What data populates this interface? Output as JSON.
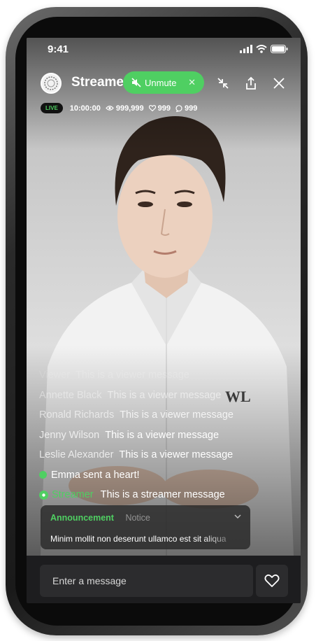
{
  "status_bar": {
    "time": "9:41"
  },
  "header": {
    "streamer_name": "Streame",
    "unmute_label": "Unmute"
  },
  "stats": {
    "live_badge": "LIVE",
    "duration": "10:00:00",
    "views": "999,999",
    "likes": "999",
    "comments": "999"
  },
  "video": {
    "watermark": "WL"
  },
  "chat": {
    "messages": [
      {
        "user": "Viewer",
        "text": "This is a viewer message"
      },
      {
        "user": "Annette Black",
        "text": "This is a viewer message"
      },
      {
        "user": "Ronald Richards",
        "text": "This is a viewer message"
      },
      {
        "user": "Jenny Wilson",
        "text": "This is a viewer message"
      },
      {
        "user": "Leslie Alexander",
        "text": "This is a viewer message"
      }
    ],
    "heart_event": "Emma sent a heart!",
    "streamer_message": {
      "user": "Streamer",
      "text": "This is a streamer message"
    }
  },
  "announcement": {
    "title": "Announcement",
    "tag": "Notice",
    "body": "Minim mollit non deserunt ullamco est sit aliqua"
  },
  "composer": {
    "placeholder": "Enter a message"
  },
  "colors": {
    "accent": "#4fcf62",
    "surface": "#2c2c2e",
    "background": "#1d1d1f"
  },
  "icons": [
    "speaker-mute-icon",
    "minimize-icon",
    "share-icon",
    "close-icon",
    "eye-icon",
    "heart-icon",
    "comment-icon",
    "chevron-down-icon"
  ]
}
